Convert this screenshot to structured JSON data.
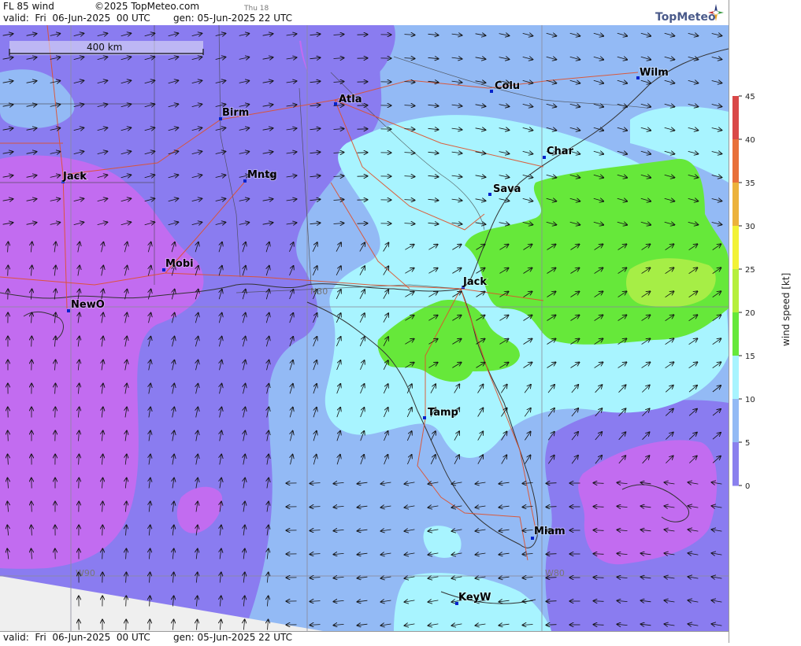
{
  "header": {
    "title": "FL 85 wind",
    "copyright": "©2025 TopMeteo.com",
    "day_hint": "Thu 18",
    "valid": "valid:  Fri  06-Jun-2025  00 UTC",
    "gen": "gen: 05-Jun-2025 22 UTC"
  },
  "logo": {
    "text": "TopMeteo",
    "icon": "compass-star-icon"
  },
  "footer": {
    "valid": "valid:  Fri  06-Jun-2025  00 UTC",
    "gen": "gen: 05-Jun-2025 22 UTC"
  },
  "map": {
    "scale_label": "400 km",
    "gridlines": {
      "lat": "N30",
      "lon_west": "W90",
      "lon_east": "W80"
    },
    "cities": [
      {
        "id": "wilm",
        "name": "Wilm"
      },
      {
        "id": "colu",
        "name": "Colu"
      },
      {
        "id": "atla",
        "name": "Atla"
      },
      {
        "id": "birm",
        "name": "Birm"
      },
      {
        "id": "char",
        "name": "Char"
      },
      {
        "id": "jack-ms",
        "name": "Jack"
      },
      {
        "id": "mntg",
        "name": "Mntg"
      },
      {
        "id": "sava",
        "name": "Sava"
      },
      {
        "id": "mobi",
        "name": "Mobi"
      },
      {
        "id": "jack-fl",
        "name": "Jack"
      },
      {
        "id": "newo",
        "name": "NewO"
      },
      {
        "id": "tamp",
        "name": "Tamp"
      },
      {
        "id": "miam",
        "name": "Miam"
      },
      {
        "id": "keyw",
        "name": "KeyW"
      }
    ]
  },
  "legend": {
    "title": "wind speed [kt]",
    "ticks": [
      "45",
      "40",
      "35",
      "30",
      "25",
      "20",
      "15",
      "10",
      "5",
      "0"
    ],
    "colors": [
      "#d94848",
      "#e8703a",
      "#ecb23c",
      "#f2f236",
      "#b6ef3c",
      "#66e83a",
      "#a8f4ff",
      "#93baf5",
      "#8a80ee",
      "#c26cf0"
    ]
  },
  "colors": {
    "slow": "#c26cf0",
    "light": "#8a7cf0",
    "moderate": "#93baf5",
    "fresh": "#a8f4ff",
    "strong": "#66e83a",
    "stronger": "#a6ee46",
    "roads": "#e0502a",
    "borders": "#333333",
    "nodata": "#efefef"
  }
}
